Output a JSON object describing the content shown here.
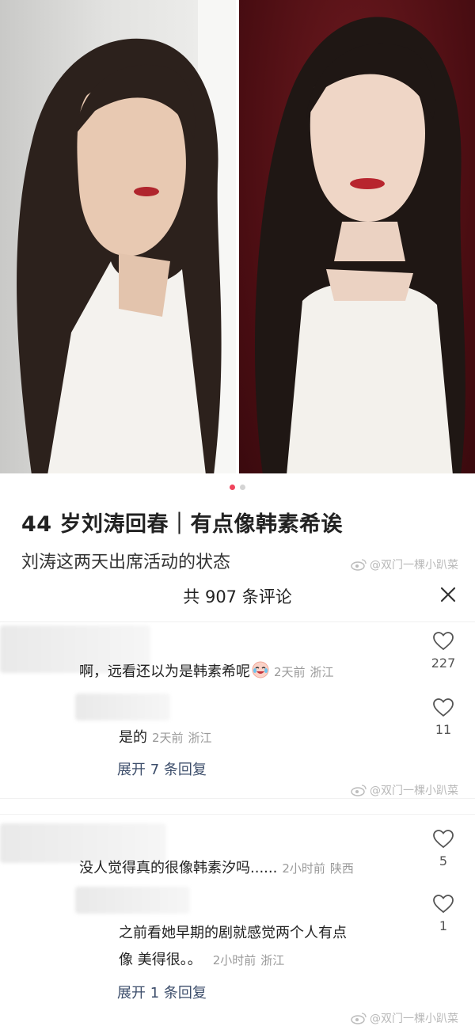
{
  "post": {
    "title": "44 岁刘涛回春｜有点像韩素希诶",
    "body": "刘涛这两天出席活动的状态",
    "carousel": {
      "count": 2,
      "active_index": 0
    }
  },
  "watermark": "@双门一棵小趴菜",
  "comments_sheet": {
    "title": "共 907 条评论",
    "threads": [
      {
        "comment": {
          "text": "啊，远看还以为是韩素希呢",
          "emoji": "crying-laughing-emoji",
          "time": "2天前",
          "region": "浙江",
          "likes": "227"
        },
        "reply": {
          "text": "是的",
          "time": "2天前",
          "region": "浙江",
          "likes": "11"
        },
        "expand_label": "展开 7 条回复"
      },
      {
        "comment": {
          "text": "没人觉得真的很像韩素汐吗......",
          "time": "2小时前",
          "region": "陕西",
          "likes": "5"
        },
        "reply": {
          "text_line1": "之前看她早期的剧就感觉两个人有点",
          "text_line2": "像 美得很。。",
          "time": "2小时前",
          "region": "浙江",
          "likes": "1"
        },
        "expand_label": "展开 1 条回复"
      }
    ]
  },
  "colors": {
    "accent": "#f0445c",
    "link": "#3d4e6b",
    "meta": "#9a9a9a"
  }
}
